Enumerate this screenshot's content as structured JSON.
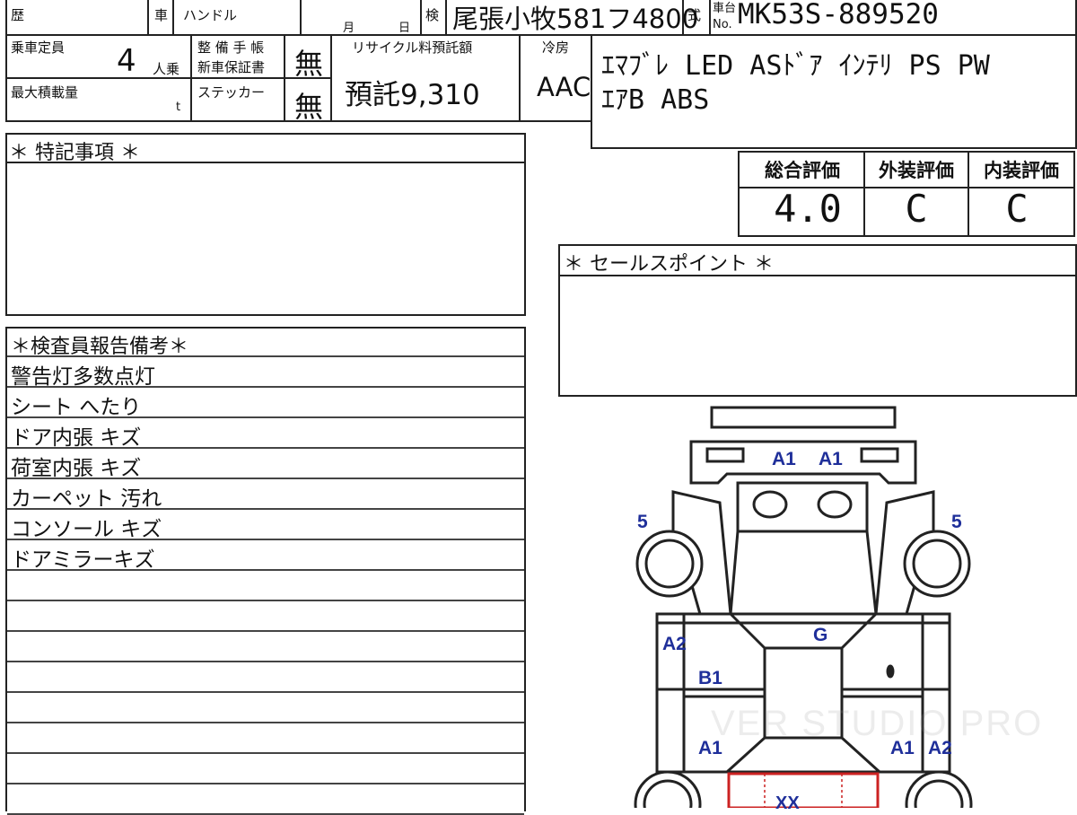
{
  "header": {
    "history_label": "歴",
    "car_label": "車",
    "handle_label": "ハンドル",
    "month_label": "月",
    "day_label": "日",
    "inspection_label": "検",
    "registration_number": "尾張小牧581フ4800",
    "type_label": "式",
    "chassis_label_top": "車台",
    "chassis_label_bottom": "No.",
    "chassis_number": "MK53S-889520"
  },
  "specs": {
    "capacity_label": "乗車定員",
    "capacity_value": "4",
    "capacity_unit": "人乗",
    "maintenance_label_1": "整 備 手 帳",
    "maintenance_label_2": "新車保証書",
    "maintenance_value": "無",
    "max_load_label": "最大積載量",
    "max_load_unit": "t",
    "sticker_label": "ステッカー",
    "sticker_value": "無",
    "recycle_label": "リサイクル料預託額",
    "recycle_value": "預託9,310",
    "cooler_label": "冷房",
    "cooler_value": "AAC"
  },
  "equipment": {
    "line1": "ｴﾏﾌﾞﾚ LED ASﾄﾞｱ ｲﾝﾃﾘ PS PW",
    "line2": "ｴｱB ABS"
  },
  "ratings": {
    "overall_label": "総合評価",
    "overall_value": "4.0",
    "exterior_label": "外装評価",
    "exterior_value": "C",
    "interior_label": "内装評価",
    "interior_value": "C"
  },
  "special_notes": {
    "title": "＊ 特記事項 ＊"
  },
  "sales_points": {
    "title": "＊ セールスポイント ＊"
  },
  "inspector_report": {
    "title": "＊検査員報告備考＊",
    "items": [
      "警告灯多数点灯",
      "シート へたり",
      "ドア内張 キズ",
      "荷室内張 キズ",
      "カーペット 汚れ",
      "コンソール キズ",
      "ドアミラーキズ",
      "",
      "",
      "",
      "",
      "",
      "",
      "",
      ""
    ]
  },
  "diagram": {
    "marks": {
      "front_bumper_left": "A1",
      "front_bumper_right": "A1",
      "front_left_wheel": "5",
      "front_right_wheel": "5",
      "left_front_fender": "A2",
      "left_front_door": "B1",
      "windshield": "G",
      "left_rear_door": "A1",
      "right_rear_door": "A1",
      "right_rear_fender": "A2",
      "rear_area": "XX"
    },
    "mark_color": "#1f2f9a",
    "highlight_color": "#cc2222"
  },
  "watermark": "VER STUDIO PRO"
}
